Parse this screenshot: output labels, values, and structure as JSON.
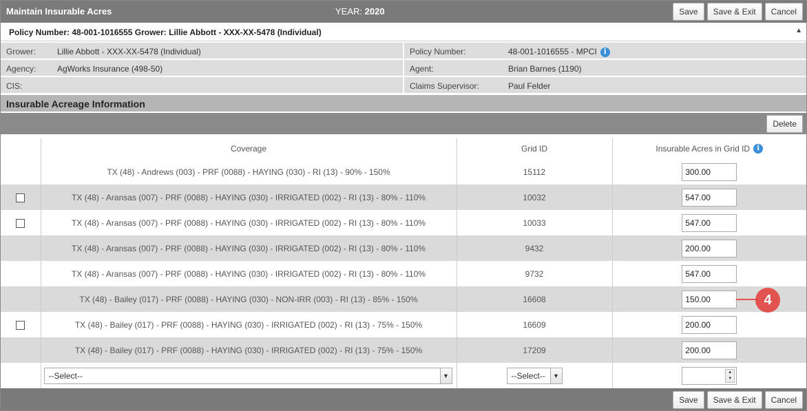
{
  "header": {
    "title": "Maintain Insurable Acres",
    "year_label": "YEAR:",
    "year_value": "2020",
    "buttons": {
      "save": "Save",
      "save_exit": "Save & Exit",
      "cancel": "Cancel"
    }
  },
  "policy_bar": {
    "text": "Policy Number: 48-001-1016555 Grower: Lillie Abbott - XXX-XX-5478 (Individual)",
    "toggle": "▲"
  },
  "info": {
    "grower_label": "Grower:",
    "grower_value": "Lillie Abbott - XXX-XX-5478 (Individual)",
    "policy_label": "Policy Number:",
    "policy_value": "48-001-1016555 - MPCI",
    "agency_label": "Agency:",
    "agency_value": "AgWorks Insurance (498-50)",
    "agent_label": "Agent:",
    "agent_value": "Brian Barnes (1190)",
    "cis_label": "CIS:",
    "cis_value": "",
    "claims_label": "Claims Supervisor:",
    "claims_value": "Paul Felder"
  },
  "section": {
    "title": "Insurable Acreage Information",
    "delete_label": "Delete"
  },
  "table": {
    "headers": {
      "coverage": "Coverage",
      "grid_id": "Grid ID",
      "acres": "Insurable Acres in Grid ID"
    },
    "rows": [
      {
        "coverage": "TX (48) - Andrews (003) - PRF (0088) - HAYING (030) - RI (13) - 90% - 150%",
        "grid_id": "15112",
        "acres": "300.00"
      },
      {
        "coverage": "TX (48) - Aransas (007) - PRF (0088) - HAYING (030) - IRRIGATED (002) - RI (13) - 80% - 110%",
        "grid_id": "10032",
        "acres": "547.00"
      },
      {
        "coverage": "TX (48) - Aransas (007) - PRF (0088) - HAYING (030) - IRRIGATED (002) - RI (13) - 80% - 110%",
        "grid_id": "10033",
        "acres": "547.00"
      },
      {
        "coverage": "TX (48) - Aransas (007) - PRF (0088) - HAYING (030) - IRRIGATED (002) - RI (13) - 80% - 110%",
        "grid_id": "9432",
        "acres": "200.00"
      },
      {
        "coverage": "TX (48) - Aransas (007) - PRF (0088) - HAYING (030) - IRRIGATED (002) - RI (13) - 80% - 110%",
        "grid_id": "9732",
        "acres": "547.00"
      },
      {
        "coverage": "TX (48) - Bailey (017) - PRF (0088) - HAYING (030) - NON-IRR (003) - RI (13) - 85% - 150%",
        "grid_id": "16608",
        "acres": "150.00"
      },
      {
        "coverage": "TX (48) - Bailey (017) - PRF (0088) - HAYING (030) - IRRIGATED (002) - RI (13) - 75% - 150%",
        "grid_id": "16609",
        "acres": "200.00"
      },
      {
        "coverage": "TX (48) - Bailey (017) - PRF (0088) - HAYING (030) - IRRIGATED (002) - RI (13) - 75% - 150%",
        "grid_id": "17209",
        "acres": "200.00"
      }
    ],
    "new_row": {
      "coverage_select": "--Select--",
      "grid_select": "--Select--",
      "acres": ""
    }
  },
  "callout": {
    "number": "4",
    "color": "#e2524f"
  },
  "footer": {
    "buttons": {
      "save": "Save",
      "save_exit": "Save & Exit",
      "cancel": "Cancel"
    }
  },
  "colors": {
    "header_bg": "#7a7a7a",
    "info_bg": "#dcdcdc",
    "alt_row": "#dadada",
    "info_icon": "#3a8fd9"
  }
}
